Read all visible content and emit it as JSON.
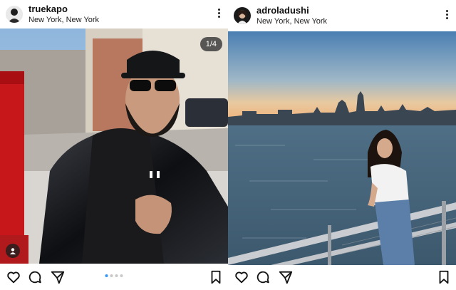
{
  "posts": [
    {
      "username": "truekapo",
      "location": "New York, New York",
      "counter": "1/4",
      "carousel_active": 0,
      "carousel_count": 4,
      "icons": [
        "more-vertical-icon",
        "heart-icon",
        "comment-icon",
        "send-icon",
        "bookmark-icon",
        "user-tag-icon"
      ]
    },
    {
      "username": "adroladushi",
      "location": "New York, New York",
      "icons": [
        "more-vertical-icon",
        "heart-icon",
        "comment-icon",
        "send-icon",
        "bookmark-icon"
      ]
    }
  ],
  "colors": {
    "accent": "#3897f0",
    "text": "#111111"
  }
}
